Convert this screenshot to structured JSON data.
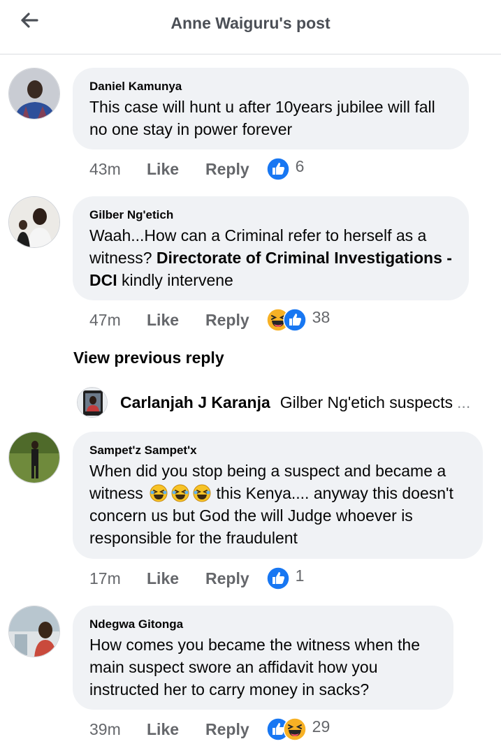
{
  "header": {
    "title": "Anne Waiguru's post",
    "back_icon": "back-arrow-icon"
  },
  "colors": {
    "like_blue": "#1877f2",
    "haha_yellow": "#f7b125",
    "bubble_bg": "#f0f2f5",
    "meta_gray": "#65676b"
  },
  "comments": [
    {
      "author": "Daniel Kamunya",
      "text_lines": [
        "This case will hunt u after 10years jubilee will fall",
        "no one stay in power forever"
      ],
      "time": "43m",
      "like_label": "Like",
      "reply_label": "Reply",
      "reactions": [
        "like-icon"
      ],
      "reaction_count": "6"
    },
    {
      "author": "Gilber Ng'etich",
      "text_line1": "Waah...How can a Criminal refer to herself as a",
      "text_line2_plain": "witness? ",
      "text_line2_bold": "Directorate of Criminal Investigations -",
      "text_line3_bold": "DCI",
      "text_line3_plain": " kindly intervene",
      "time": "47m",
      "like_label": "Like",
      "reply_label": "Reply",
      "reactions": [
        "haha-icon",
        "like-icon"
      ],
      "reaction_count": "38"
    },
    {
      "author": "Sampet'z Sampet'x",
      "text_line1": "When did you stop being a suspect and became a",
      "text_line2_pre": "witness ",
      "text_line2_emojis": [
        "rofl-emoji",
        "rofl-emoji",
        "rofl-emoji"
      ],
      "text_line2_post": " this Kenya.... anyway this doesn't",
      "text_line3": "concern us but God the will Judge whoever is",
      "text_line4": "responsible for the fraudulent",
      "time": "17m",
      "like_label": "Like",
      "reply_label": "Reply",
      "reactions": [
        "like-icon"
      ],
      "reaction_count": "1"
    },
    {
      "author": "Ndegwa Gitonga",
      "text_lines": [
        "How comes you became the witness when the",
        "main suspect swore an affidavit how you",
        "instructed her to carry money in sacks?"
      ],
      "time": "39m",
      "like_label": "Like",
      "reply_label": "Reply",
      "reactions": [
        "like-icon",
        "haha-icon"
      ],
      "reaction_count": "29"
    }
  ],
  "view_previous_reply": "View previous reply",
  "reply_preview": {
    "author": "Carlanjah J Karanja",
    "text": "Gilber Ng'etich suspects",
    "ellipsis": "..."
  }
}
